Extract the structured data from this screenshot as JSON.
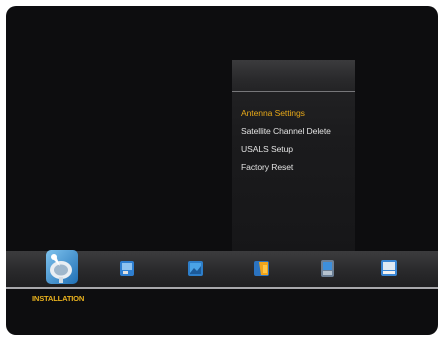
{
  "submenu": {
    "items": [
      {
        "label": "Antenna Settings",
        "selected": true
      },
      {
        "label": "Satellite Channel Delete",
        "selected": false
      },
      {
        "label": "USALS Setup",
        "selected": false
      },
      {
        "label": "Factory Reset",
        "selected": false
      }
    ]
  },
  "main_menu": {
    "active_caption": "INSTALLATION",
    "icons": [
      {
        "icon": "installation-satellite-icon",
        "active": true
      },
      {
        "icon": "channel-icon",
        "active": false
      },
      {
        "icon": "picture-icon",
        "active": false
      },
      {
        "icon": "folder-icon",
        "active": false
      },
      {
        "icon": "settings-icon",
        "active": false
      },
      {
        "icon": "monitor-icon",
        "active": false
      }
    ]
  },
  "colors": {
    "selected_text": "#e7a818",
    "normal_text": "#e2e2e2",
    "background": "#0d0d0f"
  }
}
